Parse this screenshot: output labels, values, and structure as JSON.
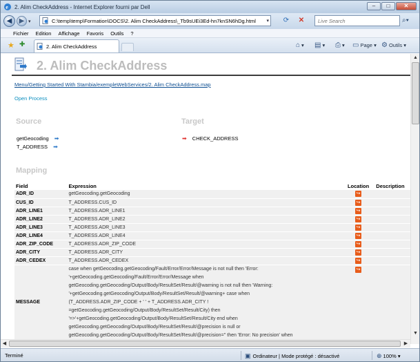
{
  "window": {
    "title": "2. Alim CheckAddress - Internet Explorer fourni par Dell",
    "min_glyph": "–",
    "max_glyph": "□",
    "close_glyph": "✕"
  },
  "address_bar": {
    "url": "C:\\temp\\temp\\Formation\\DOCS\\2. Alim CheckAddress\\_Tb9sUEi3Ed-hn7knSN6hDg.html",
    "search_placeholder": "Live Search"
  },
  "menu": [
    "Fichier",
    "Edition",
    "Affichage",
    "Favoris",
    "Outils",
    "?"
  ],
  "tabs": {
    "active_label": "2. Alim CheckAddress"
  },
  "command_bar": {
    "page_label": "Page",
    "tools_label": "Outils"
  },
  "page": {
    "title": "2. Alim CheckAddress",
    "breadcrumb": {
      "menu_link": "Menu",
      "path": "/Getting Started With Stambia/exempleWebServices/2. Alim CheckAddress.map"
    },
    "open_process": "Open Process",
    "source": {
      "heading": "Source",
      "items": [
        "getGeocoding",
        "T_ADDRESS"
      ]
    },
    "target": {
      "heading": "Target",
      "items": [
        "CHECK_ADDRESS"
      ]
    },
    "mapping": {
      "heading": "Mapping",
      "columns": {
        "field": "Field",
        "expression": "Expression",
        "location": "Location",
        "description": "Description"
      },
      "rows": [
        {
          "field": "ADR_ID",
          "expression": "getGeocoding.getGeocoding"
        },
        {
          "field": "CUS_ID",
          "expression": "T_ADDRESS.CUS_ID"
        },
        {
          "field": "ADR_LINE1",
          "expression": "T_ADDRESS.ADR_LINE1"
        },
        {
          "field": "ADR_LINE2",
          "expression": "T_ADDRESS.ADR_LINE2"
        },
        {
          "field": "ADR_LINE3",
          "expression": "T_ADDRESS.ADR_LINE3"
        },
        {
          "field": "ADR_LINE4",
          "expression": "T_ADDRESS.ADR_LINE4"
        },
        {
          "field": "ADR_ZIP_CODE",
          "expression": "T_ADDRESS.ADR_ZIP_CODE"
        },
        {
          "field": "ADR_CITY",
          "expression": "T_ADDRESS.ADR_CITY"
        },
        {
          "field": "ADR_CEDEX",
          "expression": "T_ADDRESS.ADR_CEDEX"
        }
      ],
      "message_row": {
        "field": "MESSAGE",
        "lines": [
          "case when getGeocoding.getGeocoding/Fault/Error/Error/Message is not null then 'Error:",
          "'+getGeocoding.getGeocoding/Fault/Error/Error/Message when",
          "getGeocoding.getGeocoding/Output/Body/ResultSet/Result/@warning is not null then 'Warning:",
          "'+getGeocoding.getGeocoding/Output/Body/ResultSet/Result/@warning+ case when",
          "(T_ADDRESS.ADR_ZIP_CODE + ' ' + T_ADDRESS.ADR_CITY !",
          "=getGeocoding.getGeocoding/Output/Body/ResultSet/Result/City) then",
          "'=>'+getGeocoding.getGeocoding/Output/Body/ResultSet/Result/City end when",
          "getGeocoding.getGeocoding/Output/Body/ResultSet/Result/@precision is null or",
          "getGeocoding.getGeocoding/Output/Body/ResultSet/Result/@precision='' then 'Error: No precision' when"
        ]
      }
    }
  },
  "status_bar": {
    "left": "Terminé",
    "zone": "Ordinateur | Mode protégé : désactivé",
    "zoom": "100%"
  },
  "colors": {
    "link": "#0e4f92",
    "open_process": "#0d8fbf",
    "section_heading": "#c8c8c8",
    "location_icon": "#e85c1a",
    "source_arrow": "#2e79c9",
    "target_arrow": "#e0312e"
  }
}
